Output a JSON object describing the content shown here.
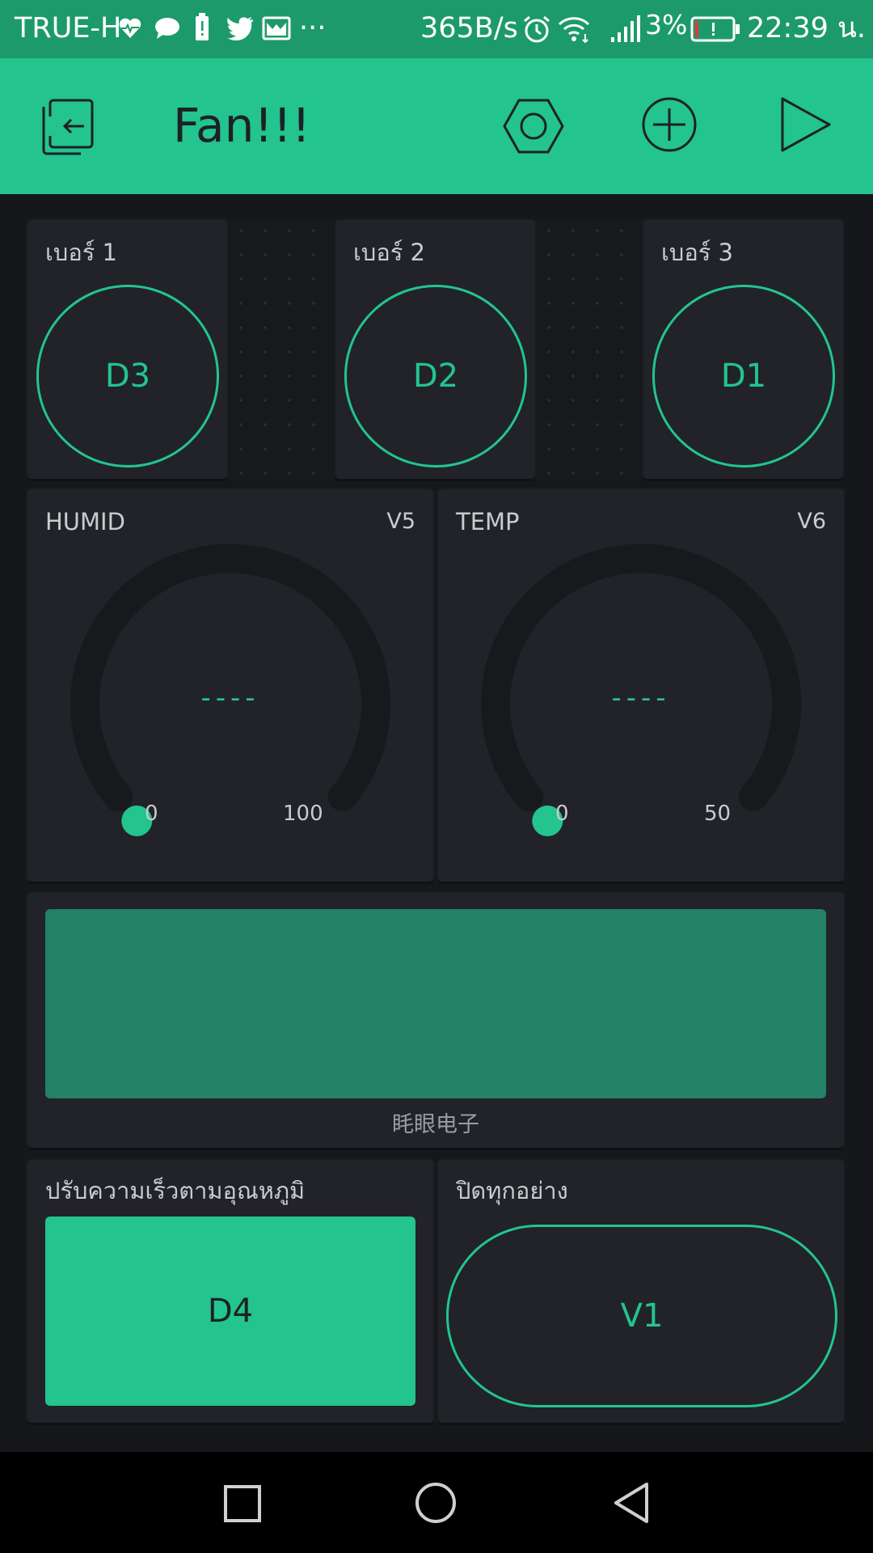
{
  "status_bar": {
    "carrier": "TRUE-H",
    "network_speed": "365B/s",
    "battery_percent": "3%",
    "time": "22:39 น.",
    "more": "···",
    "icons": [
      "heart-pulse-icon",
      "chat-bubble-icon",
      "battery-alert-icon",
      "twitter-icon",
      "mail-icon",
      "alarm-icon",
      "wifi-icon",
      "signal-icon",
      "battery-low-icon"
    ]
  },
  "header": {
    "title": "Fan!!!",
    "icons": [
      "exit-icon",
      "settings-hexagon-icon",
      "add-circle-icon",
      "play-icon"
    ]
  },
  "fan_buttons": [
    {
      "label": "เบอร์ 1",
      "pin": "D3"
    },
    {
      "label": "เบอร์ 2",
      "pin": "D2"
    },
    {
      "label": "เบอร์ 3",
      "pin": "D1"
    }
  ],
  "gauges": [
    {
      "label": "HUMID",
      "pin": "V5",
      "value": "----",
      "min": "0",
      "max": "100",
      "level": 0
    },
    {
      "label": "TEMP",
      "pin": "V6",
      "value": "----",
      "min": "0",
      "max": "50",
      "level": 0
    }
  ],
  "lcd": {
    "caption": "眊眼电子"
  },
  "controls": {
    "auto_speed": {
      "label": "ปรับความเร็วตามอุณหภูมิ",
      "pin": "D4"
    },
    "all_off": {
      "label": "ปิดทุกอย่าง",
      "pin": "V1"
    }
  },
  "colors": {
    "accent": "#23c48e",
    "header_bg": "#23c48e",
    "status_bg": "#1d9a6c",
    "tile_bg": "#212328",
    "lcd_bg": "#238266"
  }
}
